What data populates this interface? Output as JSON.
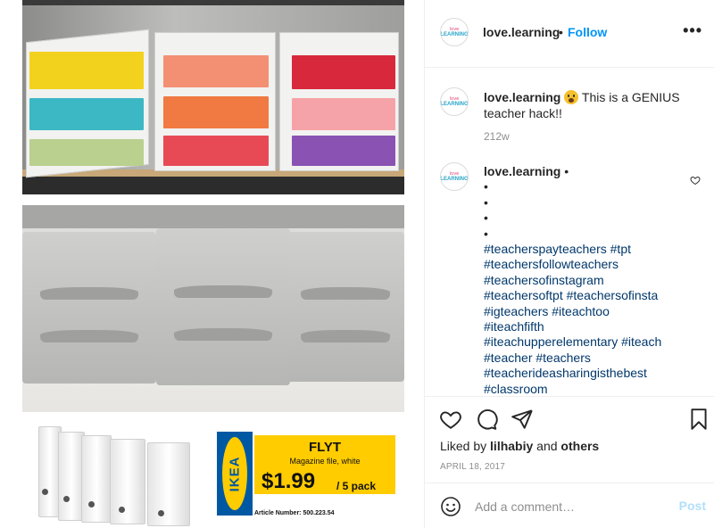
{
  "post": {
    "username": "love.learning",
    "follow_label": "Follow",
    "header_dot": "•",
    "more_label": "•••",
    "avatar_text_top": "love",
    "avatar_text_bottom": "LEARNING"
  },
  "image": {
    "product": {
      "brand": "IKEA",
      "name": "FLYT",
      "description": "Magazine file, white",
      "price": "$1.99",
      "pack": "/ 5 pack",
      "article": "Article Number: 500.223.54"
    },
    "colors": {
      "papers_left": [
        "#f2d21d",
        "#3cb8c4",
        "#b9d08f"
      ],
      "papers_mid": [
        "#f38f73",
        "#f07a41",
        "#e84a55"
      ],
      "papers_right": [
        "#d8283b",
        "#f5a3a8",
        "#8a52b3"
      ]
    }
  },
  "caption": {
    "username": "love.learning",
    "text": "This is a GENIUS teacher hack!!",
    "time": "212w"
  },
  "comment": {
    "username": "love.learning",
    "dot": "•",
    "bullets": [
      "•",
      "•",
      "•",
      "•"
    ],
    "hashtag_lines": [
      "#teacherspayteachers #tpt",
      "#teachersfollowteachers",
      "#teachersofinstagram",
      "#teachersoftpt #teachersofinsta",
      "#igteachers #iteachtoo",
      "#iteachfifth",
      "#iteachupperelementary #iteach",
      "#teacher #teachers",
      "#teacherideasharingisthebest",
      "#classroom"
    ]
  },
  "actions": {
    "liked_by_prefix": "Liked by",
    "liked_by_user": "lilhabiy",
    "liked_by_and": "and",
    "liked_by_others": "others",
    "date": "APRIL 18, 2017"
  },
  "comment_box": {
    "placeholder": "Add a comment…",
    "post_label": "Post"
  },
  "theme": {
    "link_blue": "#0095f6",
    "hashtag_blue": "#00376b",
    "muted": "#8e8e8e"
  }
}
